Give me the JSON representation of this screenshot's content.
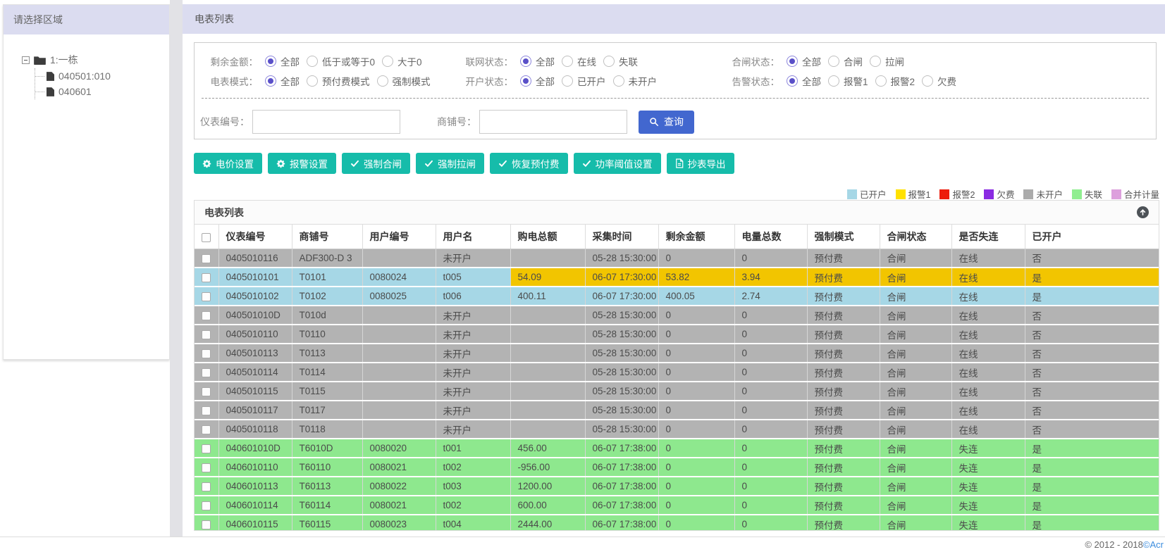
{
  "sidebar": {
    "title": "请选择区域",
    "tree": {
      "root_label": "1:一栋",
      "children": [
        "040501:010",
        "040601"
      ]
    }
  },
  "main": {
    "title": "电表列表",
    "filters": [
      {
        "label": "剩余金额：",
        "options": [
          "全部",
          "低于或等于0",
          "大于0"
        ],
        "selected": 0
      },
      {
        "label": "联网状态：",
        "options": [
          "全部",
          "在线",
          "失联"
        ],
        "selected": 0
      },
      {
        "label": "合闸状态：",
        "options": [
          "全部",
          "合闸",
          "拉闸"
        ],
        "selected": 0
      },
      {
        "label": "电表模式：",
        "options": [
          "全部",
          "预付费模式",
          "强制模式"
        ],
        "selected": 0
      },
      {
        "label": "开户状态：",
        "options": [
          "全部",
          "已开户",
          "未开户"
        ],
        "selected": 0
      },
      {
        "label": "告警状态：",
        "options": [
          "全部",
          "报警1",
          "报警2",
          "欠费"
        ],
        "selected": 0
      }
    ],
    "search": {
      "meter_label": "仪表编号：",
      "shop_label": "商铺号：",
      "meter_value": "",
      "shop_value": "",
      "query_label": "查询"
    },
    "actions": [
      {
        "label": "电价设置",
        "icon": "gear-icon"
      },
      {
        "label": "报警设置",
        "icon": "gear-icon"
      },
      {
        "label": "强制合闸",
        "icon": "check-icon"
      },
      {
        "label": "强制拉闸",
        "icon": "check-icon"
      },
      {
        "label": "恢复预付费",
        "icon": "check-icon"
      },
      {
        "label": "功率阈值设置",
        "icon": "check-icon"
      },
      {
        "label": "抄表导出",
        "icon": "file-icon"
      }
    ],
    "legend": [
      {
        "label": "已开户",
        "color": "#a6d7e6"
      },
      {
        "label": "报警1",
        "color": "#ffe100"
      },
      {
        "label": "报警2",
        "color": "#ed1c0c"
      },
      {
        "label": "欠费",
        "color": "#8a2be2"
      },
      {
        "label": "未开户",
        "color": "#ababab"
      },
      {
        "label": "失联",
        "color": "#90ee90"
      },
      {
        "label": "合并计量",
        "color": "#dda0dd"
      }
    ],
    "table": {
      "title": "电表列表",
      "columns": [
        "仪表编号",
        "商铺号",
        "用户编号",
        "用户名",
        "购电总额",
        "采集时间",
        "剩余金额",
        "电量总数",
        "强制模式",
        "合闸状态",
        "是否失连",
        "已开户"
      ],
      "rows": [
        {
          "state": "unopened",
          "cells": [
            "0405010116",
            "ADF300-D 3",
            "",
            "未开户",
            "",
            "05-28 15:30:00",
            "0",
            "0",
            "预付费",
            "合闸",
            "在线",
            "否"
          ]
        },
        {
          "state": "opened",
          "alarm_from": 4,
          "cells": [
            "0405010101",
            "T0101",
            "0080024",
            "t005",
            "54.09",
            "06-07 17:30:00",
            "53.82",
            "3.94",
            "预付费",
            "合闸",
            "在线",
            "是"
          ]
        },
        {
          "state": "opened",
          "cells": [
            "0405010102",
            "T0102",
            "0080025",
            "t006",
            "400.11",
            "06-07 17:30:00",
            "400.05",
            "2.74",
            "预付费",
            "合闸",
            "在线",
            "是"
          ]
        },
        {
          "state": "unopened",
          "cells": [
            "040501010D",
            "T010d",
            "",
            "未开户",
            "",
            "05-28 15:30:00",
            "0",
            "0",
            "预付费",
            "合闸",
            "在线",
            "否"
          ]
        },
        {
          "state": "unopened",
          "cells": [
            "0405010110",
            "T0110",
            "",
            "未开户",
            "",
            "05-28 15:30:00",
            "0",
            "0",
            "预付费",
            "合闸",
            "在线",
            "否"
          ]
        },
        {
          "state": "unopened",
          "cells": [
            "0405010113",
            "T0113",
            "",
            "未开户",
            "",
            "05-28 15:30:00",
            "0",
            "0",
            "预付费",
            "合闸",
            "在线",
            "否"
          ]
        },
        {
          "state": "unopened",
          "cells": [
            "0405010114",
            "T0114",
            "",
            "未开户",
            "",
            "05-28 15:30:00",
            "0",
            "0",
            "预付费",
            "合闸",
            "在线",
            "否"
          ]
        },
        {
          "state": "unopened",
          "cells": [
            "0405010115",
            "T0115",
            "",
            "未开户",
            "",
            "05-28 15:30:00",
            "0",
            "0",
            "预付费",
            "合闸",
            "在线",
            "否"
          ]
        },
        {
          "state": "unopened",
          "cells": [
            "0405010117",
            "T0117",
            "",
            "未开户",
            "",
            "05-28 15:30:00",
            "0",
            "0",
            "预付费",
            "合闸",
            "在线",
            "否"
          ]
        },
        {
          "state": "unopened",
          "cells": [
            "0405010118",
            "T0118",
            "",
            "未开户",
            "",
            "05-28 15:30:00",
            "0",
            "0",
            "预付费",
            "合闸",
            "在线",
            "否"
          ]
        },
        {
          "state": "lost",
          "cells": [
            "040601010D",
            "T6010D",
            "0080020",
            "t001",
            "456.00",
            "06-07 17:38:00",
            "0",
            "0",
            "预付费",
            "合闸",
            "失连",
            "是"
          ]
        },
        {
          "state": "lost",
          "cells": [
            "0406010110",
            "T60110",
            "0080021",
            "t002",
            "-956.00",
            "06-07 17:38:00",
            "0",
            "0",
            "预付费",
            "合闸",
            "失连",
            "是"
          ]
        },
        {
          "state": "lost",
          "cells": [
            "0406010113",
            "T60113",
            "0080022",
            "t003",
            "1200.00",
            "06-07 17:38:00",
            "0",
            "0",
            "预付费",
            "合闸",
            "失连",
            "是"
          ]
        },
        {
          "state": "lost",
          "cells": [
            "0406010114",
            "T60114",
            "0080021",
            "t002",
            "600.00",
            "06-07 17:38:00",
            "0",
            "0",
            "预付费",
            "合闸",
            "失连",
            "是"
          ]
        },
        {
          "state": "lost",
          "cells": [
            "0406010115",
            "T60115",
            "0080023",
            "t004",
            "2444.00",
            "06-07 17:38:00",
            "0",
            "0",
            "预付费",
            "合闸",
            "失连",
            "是"
          ]
        }
      ]
    }
  },
  "footer": {
    "prefix": "© 2012 - 2018 ",
    "link": "©Acr"
  },
  "colors": {
    "accent_blue": "#4267cf",
    "accent_teal": "#16bcaa",
    "panel_header_bg": "#dbdcf0",
    "row_unopened": "#b3b3b3",
    "row_opened": "#a6d7e6",
    "row_alarm1": "#f2c500",
    "row_lost": "#8ee88e"
  }
}
